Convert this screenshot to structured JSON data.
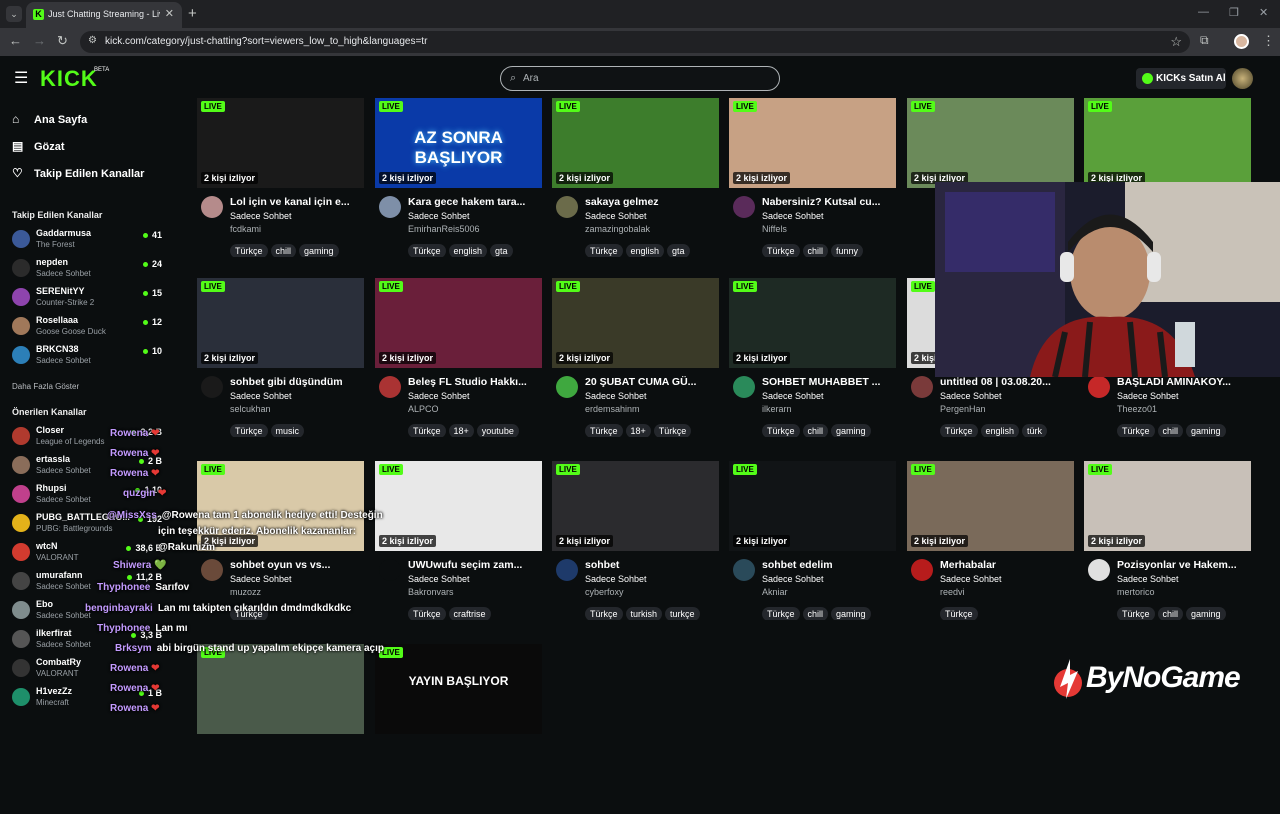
{
  "browser": {
    "tab_title": "Just Chatting Streaming - Live S",
    "url": "kick.com/category/just-chatting?sort=viewers_low_to_high&languages=tr"
  },
  "header": {
    "logo": "KICK",
    "beta": "BETA",
    "search_placeholder": "Ara",
    "kicks_button": "KICKs Satın Al"
  },
  "sidebar": {
    "nav": [
      "Ana Sayfa",
      "Gözat",
      "Takip Edilen Kanallar"
    ],
    "followed_heading": "Takip Edilen Kanallar",
    "followed": [
      {
        "name": "Gaddarmusa",
        "category": "The Forest",
        "viewers": "41",
        "color": "#3b5998"
      },
      {
        "name": "nepden",
        "category": "Sadece Sohbet",
        "viewers": "24",
        "color": "#2b2b2b"
      },
      {
        "name": "SERENitYY",
        "category": "Counter-Strike 2",
        "viewers": "15",
        "color": "#8e44ad"
      },
      {
        "name": "Rosellaaa",
        "category": "Goose Goose Duck",
        "viewers": "12",
        "color": "#a0785a"
      },
      {
        "name": "BRKCN38",
        "category": "Sadece Sohbet",
        "viewers": "10",
        "color": "#2c7fb8"
      }
    ],
    "show_more": "Daha Fazla Göster",
    "recommended_heading": "Önerilen Kanallar",
    "recommended": [
      {
        "name": "Closer",
        "category": "League of Legends",
        "viewers": "2,2 B",
        "color": "#b03a2e"
      },
      {
        "name": "ertassla",
        "category": "Sadece Sohbet",
        "viewers": "2 B",
        "color": "#8a6d5a"
      },
      {
        "name": "Rhupsi",
        "category": "Sadece Sohbet",
        "viewers": "1,10",
        "color": "#c0408c"
      },
      {
        "name": "PUBG_BATTLEGRO...",
        "category": "PUBG: Battlegrounds",
        "viewers": "192",
        "color": "#e3b21a"
      },
      {
        "name": "wtcN",
        "category": "VALORANT",
        "viewers": "38,6 B",
        "color": "#d23b2f"
      },
      {
        "name": "umurafann",
        "category": "Sadece Sohbet",
        "viewers": "11,2 B",
        "color": "#444"
      },
      {
        "name": "Ebo",
        "category": "Sadece Sohbet",
        "viewers": "",
        "color": "#7f8c8d"
      },
      {
        "name": "ilkerfirat",
        "category": "Sadece Sohbet",
        "viewers": "3,3 B",
        "color": "#555"
      },
      {
        "name": "CombatRy",
        "category": "VALORANT",
        "viewers": "",
        "color": "#333"
      },
      {
        "name": "H1vezZz",
        "category": "Minecraft",
        "viewers": "1 B",
        "color": "#1e8f6a"
      }
    ]
  },
  "cards": [
    {
      "title": "Lol için ve kanal için e...",
      "category": "Sadece Sohbet",
      "user": "fcdkami",
      "viewers": "2 kişi izliyor",
      "tags": [
        "Türkçe",
        "chill",
        "gaming"
      ],
      "thumb": "#1a1a1a",
      "av": "#b58b8b"
    },
    {
      "title": "Kara gece hakem tara...",
      "category": "Sadece Sohbet",
      "user": "EmirhanReis5006",
      "viewers": "2 kişi izliyor",
      "tags": [
        "Türkçe",
        "english",
        "gta"
      ],
      "thumb": "#0a3aa8",
      "av": "#7e8fa8",
      "thumb_text": "AZ SONRA BAŞLIYOR"
    },
    {
      "title": "sakaya gelmez",
      "category": "Sadece Sohbet",
      "user": "zamazingobalak",
      "viewers": "2 kişi izliyor",
      "tags": [
        "Türkçe",
        "english",
        "gta"
      ],
      "thumb": "#3d7d2c",
      "av": "#6b6b4a"
    },
    {
      "title": "Nabersiniz? Kutsal cu...",
      "category": "Sadece Sohbet",
      "user": "Niffels",
      "viewers": "2 kişi izliyor",
      "tags": [
        "Türkçe",
        "chill",
        "funny"
      ],
      "thumb": "#c7a184",
      "av": "#5a2b5a"
    },
    {
      "title": "",
      "category": "",
      "user": "",
      "viewers": "2 kişi izliyor",
      "tags": [],
      "thumb": "#6b8a5a",
      "av": "#444"
    },
    {
      "title": "",
      "category": "",
      "user": "",
      "viewers": "2 kişi izliyor",
      "tags": [],
      "thumb": "#5aa03a",
      "av": "#444"
    },
    {
      "title": "sohbet gibi düşündüm",
      "category": "Sadece Sohbet",
      "user": "selcukhan",
      "viewers": "2 kişi izliyor",
      "tags": [
        "Türkçe",
        "music"
      ],
      "thumb": "#2a2f3a",
      "av": "#1a1a1a"
    },
    {
      "title": "Beleş FL Studio Hakkı...",
      "category": "Sadece Sohbet",
      "user": "ALPCO",
      "viewers": "2 kişi izliyor",
      "tags": [
        "Türkçe",
        "18+",
        "youtube"
      ],
      "thumb": "#6a1f3a",
      "av": "#a33"
    },
    {
      "title": "20 ŞUBAT CUMA GÜ...",
      "category": "Sadece Sohbet",
      "user": "erdemsahinm",
      "viewers": "2 kişi izliyor",
      "tags": [
        "Türkçe",
        "18+",
        "Türkçe"
      ],
      "thumb": "#3a3a28",
      "av": "#3fa83f"
    },
    {
      "title": "SOHBET MUHABBET ...",
      "category": "Sadece Sohbet",
      "user": "ilkerarn",
      "viewers": "2 kişi izliyor",
      "tags": [
        "Türkçe",
        "chill",
        "gaming"
      ],
      "thumb": "#1e2a24",
      "av": "#2a8a5a"
    },
    {
      "title": "untitled 08 | 03.08.20...",
      "category": "Sadece Sohbet",
      "user": "PergenHan",
      "viewers": "2 kişi izliyor",
      "tags": [
        "Türkçe",
        "english",
        "türk"
      ],
      "thumb": "#dcdcdc",
      "av": "#7a3a3a"
    },
    {
      "title": "BAŞLADI AMINAKOY...",
      "category": "Sadece Sohbet",
      "user": "Theezo01",
      "viewers": "",
      "tags": [
        "Türkçe",
        "chill",
        "gaming"
      ],
      "thumb": "#222",
      "av": "#c62828"
    },
    {
      "title": "sohbet oyun vs vs...",
      "category": "Sadece Sohbet",
      "user": "muzozz",
      "viewers": "2 kişi izliyor",
      "tags": [
        "Türkçe"
      ],
      "thumb": "#d9c9a8",
      "av": "#6a4a3a"
    },
    {
      "title": "UWUwufu seçim zam...",
      "category": "Sadece Sohbet",
      "user": "Bakronvars",
      "viewers": "2 kişi izliyor",
      "tags": [
        "Türkçe",
        "craftrise"
      ],
      "thumb": "#e8e8e8",
      "av": "#0b0e0f"
    },
    {
      "title": "sohbet",
      "category": "Sadece Sohbet",
      "user": "cyberfoxy",
      "viewers": "2 kişi izliyor",
      "tags": [
        "Türkçe",
        "turkish",
        "turkçe"
      ],
      "thumb": "#2b2b2e",
      "av": "#1e3a6a"
    },
    {
      "title": "sohbet edelim",
      "category": "Sadece Sohbet",
      "user": "Akniar",
      "viewers": "2 kişi izliyor",
      "tags": [
        "Türkçe",
        "chill",
        "gaming"
      ],
      "thumb": "#111416",
      "av": "#2a4a5a"
    },
    {
      "title": "Merhabalar",
      "category": "Sadece Sohbet",
      "user": "reedvi",
      "viewers": "2 kişi izliyor",
      "tags": [
        "Türkçe"
      ],
      "thumb": "#7a6a5a",
      "av": "#b71c1c"
    },
    {
      "title": "Pozisyonlar ve Hakem...",
      "category": "Sadece Sohbet",
      "user": "mertorico",
      "viewers": "2 kişi izliyor",
      "tags": [
        "Türkçe",
        "chill",
        "gaming"
      ],
      "thumb": "#c8c0b8",
      "av": "#e0e0e0"
    },
    {
      "title": "",
      "category": "",
      "user": "",
      "viewers": "",
      "tags": [],
      "thumb": "#4a5a4a",
      "av": "#444"
    },
    {
      "title": "",
      "category": "",
      "user": "",
      "viewers": "",
      "tags": [],
      "thumb": "#0a0a0a",
      "av": "#444",
      "thumb_text": "YAYIN BAŞLIYOR"
    }
  ],
  "live_label": "LIVE",
  "chat": [
    {
      "name": "Rowena",
      "text": ""
    },
    {
      "name": "Rowena",
      "text": ""
    },
    {
      "name": "Rowena",
      "text": ""
    },
    {
      "name": "quzgin",
      "text": ""
    },
    {
      "name": "@MissXss",
      "text": "@Rowena tam 1 abonelik hediye etti! Desteğin"
    },
    {
      "name": "",
      "text": "için teşekkür ederiz. Abonelik kazananlar:"
    },
    {
      "name": "",
      "text": "@Rakunizm"
    },
    {
      "name": "Shiwera",
      "text": ""
    },
    {
      "name": "Thyphonee",
      "text": "Sarıfov"
    },
    {
      "name": "benginbayraki",
      "text": "Lan mı takipten çıkarıldın dmdmdkdkdkc"
    },
    {
      "name": "Thyphonee",
      "text": "Lan mı"
    },
    {
      "name": "Brksym",
      "text": "abi birgün stand up yapalım ekipçe kamera açıp"
    },
    {
      "name": "Rowena",
      "text": ""
    },
    {
      "name": "Rowena",
      "text": ""
    },
    {
      "name": "Rowena",
      "text": ""
    }
  ],
  "sponsor": "ByNoGame"
}
